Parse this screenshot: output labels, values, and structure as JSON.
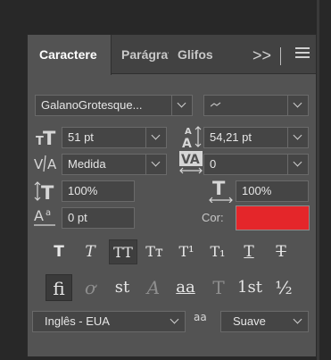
{
  "tabs": [
    {
      "label": "Caractere",
      "active": true
    },
    {
      "label": "Parágrafo",
      "active": false
    },
    {
      "label": "Glifos",
      "active": false
    }
  ],
  "tab_overflow": ">>",
  "font_family": "GalanoGrotesque...",
  "font_style": "",
  "font_size": "51 pt",
  "leading": "54,21 pt",
  "kerning": "Medida",
  "tracking": "0",
  "vertical_scale": "100%",
  "horizontal_scale": "100%",
  "baseline_shift": "0 pt",
  "color_label": "Cor:",
  "color_value": "#e4262a",
  "style_buttons": [
    {
      "name": "faux-bold",
      "glyph": "T"
    },
    {
      "name": "faux-italic",
      "glyph": "T"
    },
    {
      "name": "all-caps",
      "glyph": "TT"
    },
    {
      "name": "small-caps",
      "glyph": "Tт"
    },
    {
      "name": "superscript",
      "glyph": "T¹"
    },
    {
      "name": "subscript",
      "glyph": "T₁"
    },
    {
      "name": "underline",
      "glyph": "T"
    },
    {
      "name": "strikethrough",
      "glyph": "T"
    }
  ],
  "feature_buttons": [
    {
      "name": "ligatures",
      "glyph": "fi"
    },
    {
      "name": "discretionary-ligatures",
      "glyph": "ơ"
    },
    {
      "name": "historical",
      "glyph": "st"
    },
    {
      "name": "swash",
      "glyph": "A"
    },
    {
      "name": "stylistic-alternates",
      "glyph": "aa"
    },
    {
      "name": "titling",
      "glyph": "T"
    },
    {
      "name": "ordinals",
      "glyph": "1st"
    },
    {
      "name": "fractions",
      "glyph": "½"
    }
  ],
  "language": "Inglês - EUA",
  "antialias_icon_text": "aa",
  "antialias": "Suave"
}
